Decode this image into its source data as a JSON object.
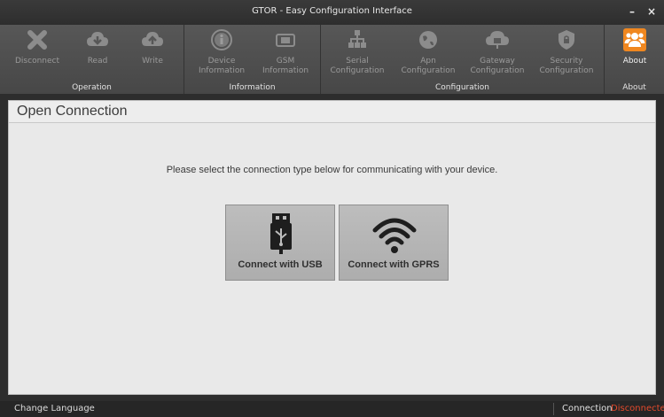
{
  "window": {
    "title": "GTOR - Easy Configuration Interface",
    "minimize": "–",
    "close": "×"
  },
  "ribbon": {
    "groups": {
      "operation": "Operation",
      "information": "Information",
      "configuration": "Configuration",
      "about": "About"
    },
    "buttons": {
      "disconnect": "Disconnect",
      "read": "Read",
      "write": "Write",
      "device_info": [
        "Device",
        "Information"
      ],
      "gsm_info": [
        "GSM",
        "Information"
      ],
      "serial_config": [
        "Serial",
        "Configuration"
      ],
      "apn_config": [
        "Apn",
        "Configuration"
      ],
      "gateway_config": [
        "Gateway",
        "Configuration"
      ],
      "security_config": [
        "Security",
        "Configuration"
      ],
      "about": "About"
    },
    "colors": {
      "about_icon_bg": "#f0871f",
      "disabled_icon": "#8c8c8c"
    }
  },
  "panel": {
    "title": "Open Connection",
    "prompt": "Please select the connection type below for communicating with your device.",
    "usb_button": "Connect with USB",
    "gprs_button": "Connect with GPRS"
  },
  "status": {
    "language": "Change Language",
    "connection_label": "Connection",
    "connection_value": "Disconnected",
    "connection_color": "#e24a2c"
  }
}
